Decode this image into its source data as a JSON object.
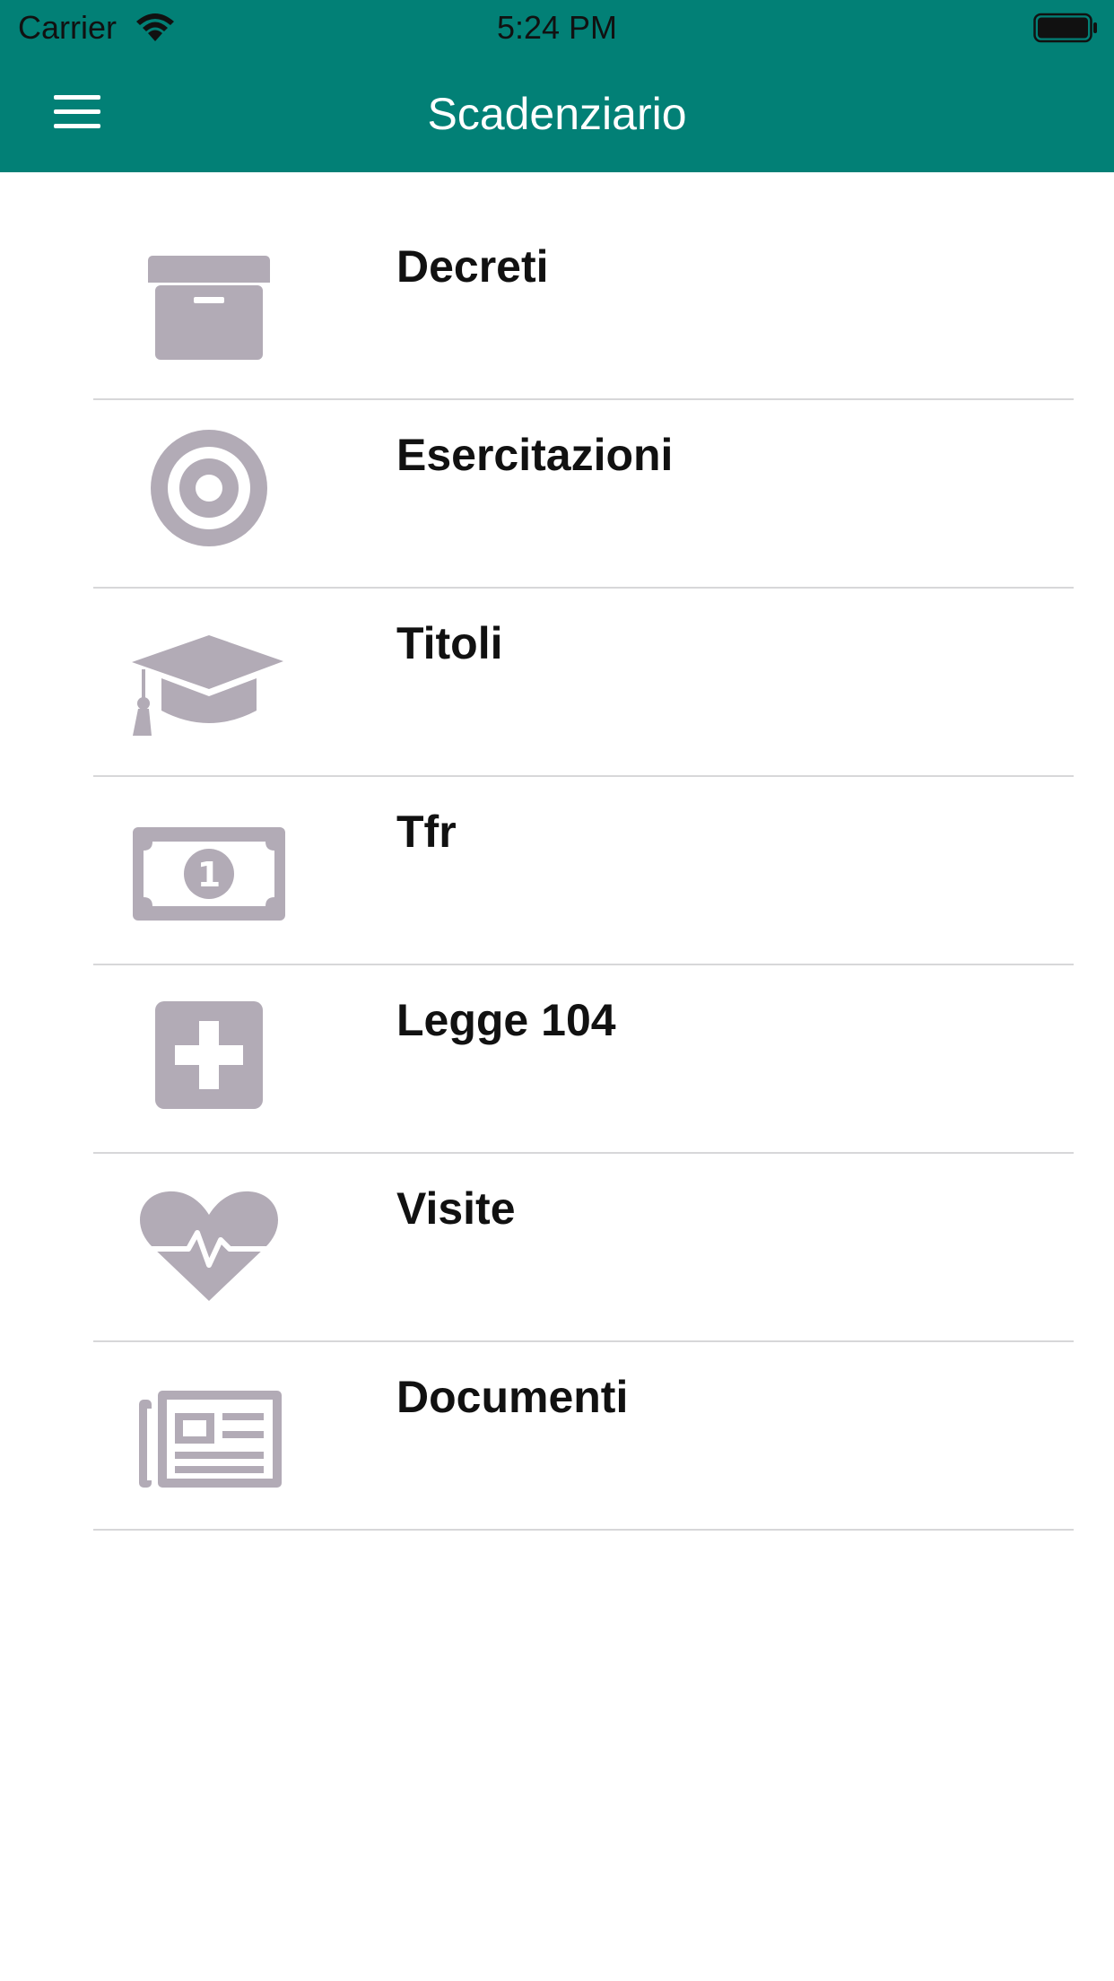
{
  "status_bar": {
    "carrier": "Carrier",
    "time": "5:24 PM"
  },
  "navbar": {
    "title": "Scadenziario",
    "menu_icon": "hamburger-menu-icon"
  },
  "colors": {
    "navbar_bg": "#028076",
    "icon_gray": "#b2abb6",
    "separator": "#d7d7d9"
  },
  "menu_items": [
    {
      "label": "Decreti",
      "icon": "archive-box-icon"
    },
    {
      "label": "Esercitazioni",
      "icon": "target-icon"
    },
    {
      "label": "Titoli",
      "icon": "graduation-cap-icon"
    },
    {
      "label": "Tfr",
      "icon": "money-bill-icon"
    },
    {
      "label": "Legge 104",
      "icon": "medical-plus-icon"
    },
    {
      "label": "Visite",
      "icon": "heartbeat-icon"
    },
    {
      "label": "Documenti",
      "icon": "newspaper-icon"
    }
  ]
}
